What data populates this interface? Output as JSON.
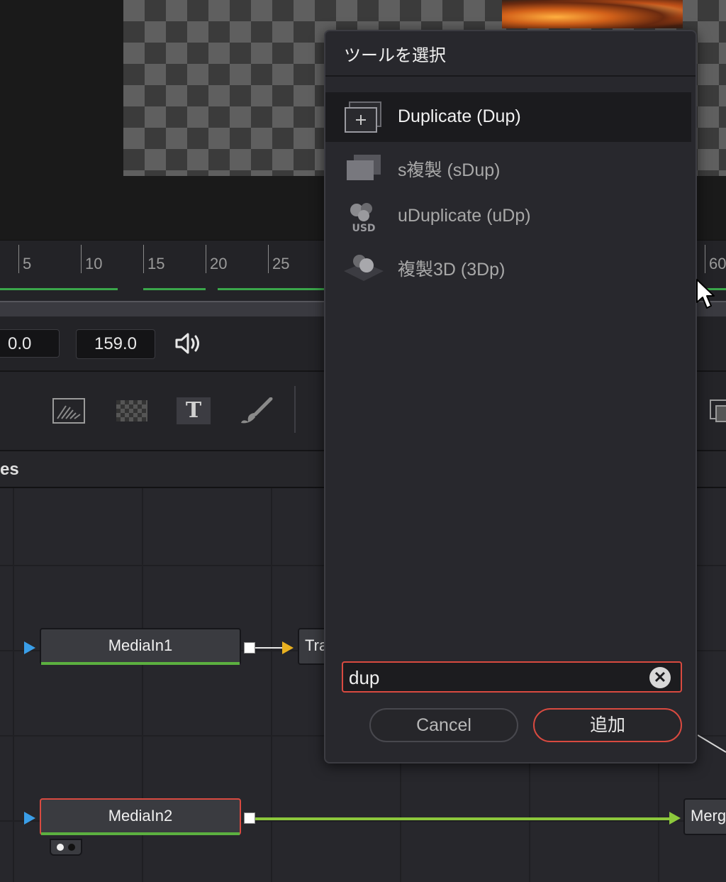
{
  "viewer": {},
  "ruler": {
    "ticks": [
      "5",
      "10",
      "15",
      "20",
      "25",
      "60"
    ]
  },
  "time": {
    "start": "0.0",
    "end": "159.0"
  },
  "toolbar": {
    "icons": [
      "background-icon",
      "checker-icon",
      "text-icon",
      "paint-icon"
    ],
    "text_tool_glyph": "T"
  },
  "nodes_panel": {
    "header_label": "es"
  },
  "nodes": {
    "mediain1": "MediaIn1",
    "transform_partial": "Tra",
    "mediain2": "MediaIn2",
    "merge_partial": "Merg"
  },
  "dialog": {
    "title": "ツールを選択",
    "items": [
      {
        "label": "Duplicate (Dup)",
        "icon": "duplicate-icon",
        "selected": true
      },
      {
        "label": "s複製 (sDup)",
        "icon": "sduplicate-icon",
        "selected": false
      },
      {
        "label": "uDuplicate (uDp)",
        "icon": "usd-duplicate-icon",
        "icon_text": "USD",
        "selected": false
      },
      {
        "label": "複製3D (3Dp)",
        "icon": "duplicate3d-icon",
        "selected": false
      }
    ],
    "search": {
      "value": "dup"
    },
    "clear_glyph": "✕",
    "cancel_label": "Cancel",
    "add_label": "追加"
  },
  "colors": {
    "accent_red": "#d94a40",
    "green_bar": "#5cb040",
    "input_triangle_blue": "#3a9ee8",
    "input_triangle_yellow": "#e8b020",
    "connection_green": "#8cc83c"
  }
}
